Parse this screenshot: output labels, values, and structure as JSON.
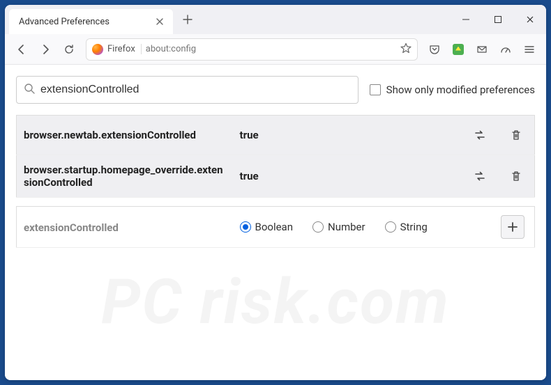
{
  "tab": {
    "title": "Advanced Preferences"
  },
  "urlbar": {
    "identity": "Firefox",
    "url": "about:config"
  },
  "search": {
    "value": "extensionControlled"
  },
  "modifiedOnly": {
    "label": "Show only modified preferences"
  },
  "prefs": [
    {
      "name": "browser.newtab.extensionControlled",
      "value": "true"
    },
    {
      "name": "browser.startup.homepage_override.extensionControlled",
      "value": "true"
    }
  ],
  "newPref": {
    "name": "extensionControlled",
    "types": {
      "boolean": "Boolean",
      "number": "Number",
      "string": "String"
    }
  },
  "watermark": "PC risk.com"
}
